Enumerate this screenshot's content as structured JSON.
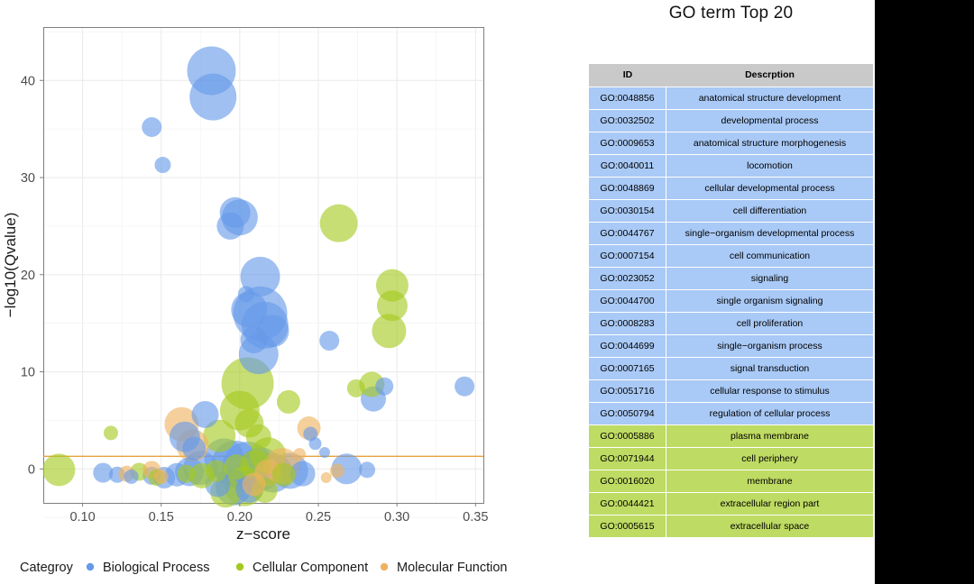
{
  "chart_data": {
    "type": "scatter",
    "title": "",
    "xlabel": "z−score",
    "ylabel": "−log10(Qvalue)",
    "xlim": [
      0.075,
      0.355
    ],
    "ylim": [
      -3.5,
      45.5
    ],
    "xticks": [
      "0.10",
      "0.15",
      "0.20",
      "0.25",
      "0.30",
      "0.35"
    ],
    "xtick_values": [
      0.1,
      0.15,
      0.2,
      0.25,
      0.3,
      0.35
    ],
    "yticks": [
      "0",
      "10",
      "20",
      "30",
      "40"
    ],
    "ytick_values": [
      0,
      10,
      20,
      30,
      40
    ],
    "grid": true,
    "legend_position": "bottom",
    "legend_title": "Categroy",
    "threshold_line": {
      "y": 1.3,
      "color": "#E8A33D"
    },
    "series": [
      {
        "name": "Biological Process",
        "color": "#6699e8",
        "points": [
          {
            "x": 0.182,
            "y": 41.0,
            "r": 27
          },
          {
            "x": 0.183,
            "y": 38.3,
            "r": 26
          },
          {
            "x": 0.144,
            "y": 35.2,
            "r": 11
          },
          {
            "x": 0.151,
            "y": 31.3,
            "r": 9
          },
          {
            "x": 0.197,
            "y": 26.4,
            "r": 17
          },
          {
            "x": 0.2,
            "y": 25.9,
            "r": 20
          },
          {
            "x": 0.194,
            "y": 25.0,
            "r": 15
          },
          {
            "x": 0.213,
            "y": 19.8,
            "r": 22
          },
          {
            "x": 0.204,
            "y": 18.0,
            "r": 9
          },
          {
            "x": 0.206,
            "y": 16.4,
            "r": 20
          },
          {
            "x": 0.213,
            "y": 16.0,
            "r": 30
          },
          {
            "x": 0.216,
            "y": 14.8,
            "r": 26
          },
          {
            "x": 0.221,
            "y": 14.2,
            "r": 18
          },
          {
            "x": 0.209,
            "y": 13.3,
            "r": 15
          },
          {
            "x": 0.212,
            "y": 11.8,
            "r": 22
          },
          {
            "x": 0.257,
            "y": 13.2,
            "r": 11
          },
          {
            "x": 0.292,
            "y": 8.5,
            "r": 10
          },
          {
            "x": 0.285,
            "y": 7.2,
            "r": 14
          },
          {
            "x": 0.343,
            "y": 8.5,
            "r": 11
          },
          {
            "x": 0.178,
            "y": 5.6,
            "r": 15
          },
          {
            "x": 0.165,
            "y": 3.3,
            "r": 17
          },
          {
            "x": 0.171,
            "y": 2.1,
            "r": 13
          },
          {
            "x": 0.245,
            "y": 3.6,
            "r": 8
          },
          {
            "x": 0.248,
            "y": 2.6,
            "r": 7
          },
          {
            "x": 0.254,
            "y": 1.7,
            "r": 6
          },
          {
            "x": 0.19,
            "y": 1.1,
            "r": 22
          },
          {
            "x": 0.197,
            "y": 0.5,
            "r": 26
          },
          {
            "x": 0.205,
            "y": 0.2,
            "r": 28
          },
          {
            "x": 0.213,
            "y": 0.0,
            "r": 24
          },
          {
            "x": 0.221,
            "y": -0.4,
            "r": 22
          },
          {
            "x": 0.175,
            "y": 0.1,
            "r": 19
          },
          {
            "x": 0.168,
            "y": -0.3,
            "r": 16
          },
          {
            "x": 0.16,
            "y": -0.6,
            "r": 13
          },
          {
            "x": 0.152,
            "y": -0.9,
            "r": 12
          },
          {
            "x": 0.144,
            "y": -0.7,
            "r": 10
          },
          {
            "x": 0.232,
            "y": -0.2,
            "r": 20
          },
          {
            "x": 0.24,
            "y": -0.5,
            "r": 14
          },
          {
            "x": 0.113,
            "y": -0.4,
            "r": 11
          },
          {
            "x": 0.122,
            "y": -0.6,
            "r": 9
          },
          {
            "x": 0.131,
            "y": -0.8,
            "r": 8
          },
          {
            "x": 0.268,
            "y": 0.0,
            "r": 17
          },
          {
            "x": 0.281,
            "y": -0.1,
            "r": 9
          },
          {
            "x": 0.196,
            "y": -1.9,
            "r": 20
          },
          {
            "x": 0.186,
            "y": -1.6,
            "r": 14
          },
          {
            "x": 0.206,
            "y": -2.1,
            "r": 15
          }
        ]
      },
      {
        "name": "Cellular Component",
        "color": "#a4c91f",
        "points": [
          {
            "x": 0.263,
            "y": 25.3,
            "r": 21
          },
          {
            "x": 0.297,
            "y": 18.9,
            "r": 18
          },
          {
            "x": 0.297,
            "y": 16.8,
            "r": 17
          },
          {
            "x": 0.295,
            "y": 14.2,
            "r": 19
          },
          {
            "x": 0.274,
            "y": 8.3,
            "r": 10
          },
          {
            "x": 0.284,
            "y": 8.7,
            "r": 14
          },
          {
            "x": 0.205,
            "y": 8.8,
            "r": 29
          },
          {
            "x": 0.2,
            "y": 6.0,
            "r": 22
          },
          {
            "x": 0.206,
            "y": 4.7,
            "r": 16
          },
          {
            "x": 0.187,
            "y": 3.4,
            "r": 18
          },
          {
            "x": 0.118,
            "y": 3.7,
            "r": 8
          },
          {
            "x": 0.212,
            "y": 3.3,
            "r": 14
          },
          {
            "x": 0.231,
            "y": 6.9,
            "r": 13
          },
          {
            "x": 0.218,
            "y": 1.4,
            "r": 20
          },
          {
            "x": 0.21,
            "y": 0.4,
            "r": 17
          },
          {
            "x": 0.198,
            "y": 0.2,
            "r": 14
          },
          {
            "x": 0.185,
            "y": -0.2,
            "r": 12
          },
          {
            "x": 0.176,
            "y": -0.7,
            "r": 14
          },
          {
            "x": 0.166,
            "y": -0.5,
            "r": 10
          },
          {
            "x": 0.085,
            "y": -0.1,
            "r": 18
          },
          {
            "x": 0.136,
            "y": -0.3,
            "r": 10
          },
          {
            "x": 0.147,
            "y": -0.9,
            "r": 9
          },
          {
            "x": 0.228,
            "y": -0.6,
            "r": 13
          },
          {
            "x": 0.203,
            "y": -1.8,
            "r": 22
          },
          {
            "x": 0.191,
            "y": -2.4,
            "r": 17
          },
          {
            "x": 0.216,
            "y": -2.2,
            "r": 14
          }
        ]
      },
      {
        "name": "Molecular Function",
        "color": "#efb35f",
        "points": [
          {
            "x": 0.163,
            "y": 4.6,
            "r": 19
          },
          {
            "x": 0.17,
            "y": 2.4,
            "r": 18
          },
          {
            "x": 0.244,
            "y": 4.2,
            "r": 13
          },
          {
            "x": 0.238,
            "y": 1.5,
            "r": 7
          },
          {
            "x": 0.227,
            "y": 0.3,
            "r": 20
          },
          {
            "x": 0.218,
            "y": -0.4,
            "r": 15
          },
          {
            "x": 0.144,
            "y": -0.1,
            "r": 10
          },
          {
            "x": 0.15,
            "y": -0.8,
            "r": 8
          },
          {
            "x": 0.128,
            "y": -0.5,
            "r": 9
          },
          {
            "x": 0.209,
            "y": -1.6,
            "r": 13
          },
          {
            "x": 0.262,
            "y": -0.2,
            "r": 8
          },
          {
            "x": 0.255,
            "y": -0.9,
            "r": 6
          }
        ]
      }
    ]
  },
  "table": {
    "title": "GO term Top 20",
    "columns": [
      "ID",
      "Descrption"
    ],
    "rows": [
      {
        "id": "GO:0048856",
        "description": "anatomical structure development",
        "category": "bp"
      },
      {
        "id": "GO:0032502",
        "description": "developmental process",
        "category": "bp"
      },
      {
        "id": "GO:0009653",
        "description": "anatomical structure morphogenesis",
        "category": "bp"
      },
      {
        "id": "GO:0040011",
        "description": "locomotion",
        "category": "bp"
      },
      {
        "id": "GO:0048869",
        "description": "cellular developmental process",
        "category": "bp"
      },
      {
        "id": "GO:0030154",
        "description": "cell differentiation",
        "category": "bp"
      },
      {
        "id": "GO:0044767",
        "description": "single−organism developmental process",
        "category": "bp"
      },
      {
        "id": "GO:0007154",
        "description": "cell communication",
        "category": "bp"
      },
      {
        "id": "GO:0023052",
        "description": "signaling",
        "category": "bp"
      },
      {
        "id": "GO:0044700",
        "description": "single organism signaling",
        "category": "bp"
      },
      {
        "id": "GO:0008283",
        "description": "cell proliferation",
        "category": "bp"
      },
      {
        "id": "GO:0044699",
        "description": "single−organism process",
        "category": "bp"
      },
      {
        "id": "GO:0007165",
        "description": "signal transduction",
        "category": "bp"
      },
      {
        "id": "GO:0051716",
        "description": "cellular response to stimulus",
        "category": "bp"
      },
      {
        "id": "GO:0050794",
        "description": "regulation of cellular process",
        "category": "bp"
      },
      {
        "id": "GO:0005886",
        "description": "plasma membrane",
        "category": "cc"
      },
      {
        "id": "GO:0071944",
        "description": "cell periphery",
        "category": "cc"
      },
      {
        "id": "GO:0016020",
        "description": "membrane",
        "category": "cc"
      },
      {
        "id": "GO:0044421",
        "description": "extracellular region part",
        "category": "cc"
      },
      {
        "id": "GO:0005615",
        "description": "extracellular space",
        "category": "cc"
      }
    ]
  },
  "colors": {
    "biological_process": "#6699e8",
    "cellular_component": "#a4c91f",
    "molecular_function": "#efb35f",
    "table_header": "#c9c9c9",
    "row_bp": "#a9c9f6",
    "row_cc": "#bedb63",
    "threshold_line": "#e8a33d"
  }
}
